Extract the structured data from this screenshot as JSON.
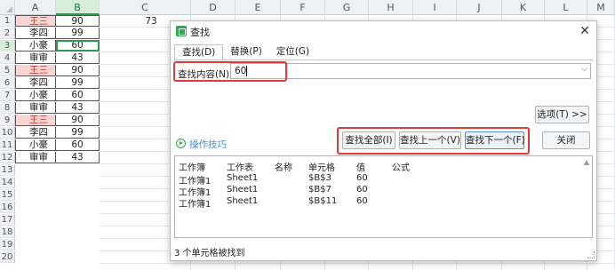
{
  "sheet": {
    "columns": [
      "A",
      "B",
      "C",
      "D",
      "E",
      "F",
      "G",
      "H",
      "I",
      "J",
      "K",
      "L",
      "M"
    ],
    "rows": [
      "1",
      "2",
      "3",
      "4",
      "5",
      "6",
      "7",
      "8",
      "9",
      "10",
      "11",
      "12",
      "13",
      "14",
      "15",
      "16",
      "17",
      "18",
      "19",
      "20"
    ],
    "col_a": [
      "王三",
      "李四",
      "小豪",
      "审审",
      "王三",
      "李四",
      "小豪",
      "审审",
      "王三",
      "李四",
      "小豪",
      "审审"
    ],
    "col_b": [
      "90",
      "99",
      "60",
      "43",
      "90",
      "99",
      "60",
      "43",
      "90",
      "99",
      "60",
      "43"
    ],
    "c1": "73",
    "highlight_color": "#fbd4d4"
  },
  "dialog": {
    "title": "查找",
    "close_icon": "close-icon",
    "tabs": [
      "查找(D)",
      "替换(P)",
      "定位(G)"
    ],
    "find_label": "查找内容(N):",
    "find_value": "60",
    "options_button": "选项(T) >>",
    "tips_label": "操作技巧",
    "buttons": {
      "find_all": "查找全部(I)",
      "find_prev": "查找上一个(V)",
      "find_next": "查找下一个(F)",
      "close": "关闭"
    },
    "results": {
      "headers": [
        "工作簿",
        "工作表",
        "名称",
        "单元格",
        "值",
        "公式"
      ],
      "rows": [
        [
          "工作簿1",
          "Sheet1",
          "",
          "$B$3",
          "60",
          ""
        ],
        [
          "工作簿1",
          "Sheet1",
          "",
          "$B$7",
          "60",
          ""
        ],
        [
          "工作簿1",
          "Sheet1",
          "",
          "$B$11",
          "60",
          ""
        ]
      ]
    },
    "status": "3 个单元格被找到",
    "accent_color": "#2fa84f",
    "annotation_color": "#e53935"
  }
}
